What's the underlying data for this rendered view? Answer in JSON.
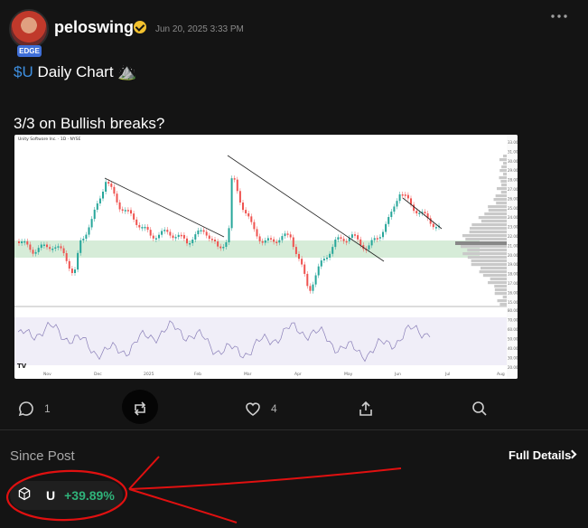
{
  "post": {
    "username": "peloswing",
    "badge": "EDGE",
    "timestamp": "Jun 20, 2025 3:33 PM",
    "line1_cashtag": "$U",
    "line1_rest": " Daily Chart ⛰️",
    "line2": "3/3 on Bullish breaks?"
  },
  "actions": {
    "comment_count": "1",
    "like_count": "4"
  },
  "chart_image": {
    "title_text": "Unity Software Inc. · 1D · NYSE",
    "x_labels": [
      "Nov",
      "Dec",
      "2025",
      "Feb",
      "Mar",
      "Apr",
      "May",
      "Jun",
      "Jul",
      "Aug"
    ],
    "price_labels": [
      "33.00",
      "31.00",
      "30.00",
      "29.00",
      "28.00",
      "27.00",
      "26.00",
      "25.00",
      "24.00",
      "23.00",
      "22.00",
      "21.00",
      "20.00",
      "19.00",
      "18.00",
      "17.00",
      "16.00",
      "15.00"
    ],
    "rsi_labels": [
      "80.00",
      "70.00",
      "60.00",
      "50.00",
      "40.00",
      "30.00",
      "20.00"
    ]
  },
  "since_post": {
    "label": "Since Post",
    "details_label": "Full Details",
    "ticker": "U",
    "change": "+39.89%"
  },
  "colors": {
    "background": "#141414",
    "cashtag": "#3e8fe0",
    "positive": "#2fb37a",
    "annotation": "#e01010",
    "candle_up": "#26a69a",
    "candle_down": "#ef5350"
  }
}
